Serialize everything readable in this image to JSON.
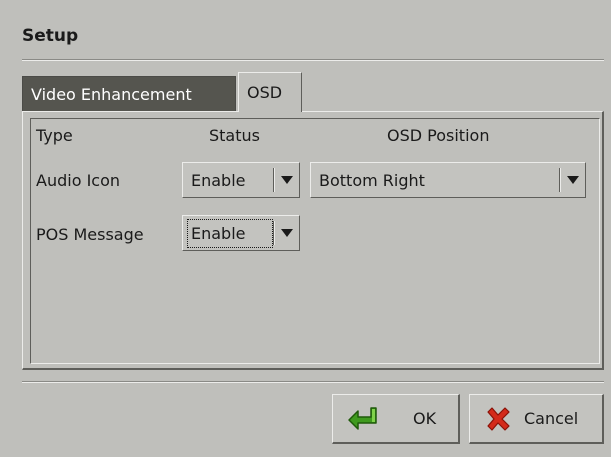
{
  "window": {
    "title": "Setup"
  },
  "tabs": [
    {
      "label": "Video Enhancement",
      "active": false
    },
    {
      "label": "OSD",
      "active": true
    }
  ],
  "osd": {
    "headers": {
      "type": "Type",
      "status": "Status",
      "position": "OSD Position"
    },
    "rows": [
      {
        "type": "Audio Icon",
        "status": "Enable",
        "position": "Bottom Right"
      },
      {
        "type": "POS Message",
        "status": "Enable"
      }
    ]
  },
  "buttons": {
    "ok": {
      "label": "OK",
      "icon": "green-check-arrow-icon"
    },
    "cancel": {
      "label": "Cancel",
      "icon": "red-x-icon"
    }
  },
  "colors": {
    "background": "#bfbfbb",
    "inactive_tab": "#55554f",
    "ok_icon": "#3f9a1e",
    "cancel_icon": "#d42a1a"
  }
}
